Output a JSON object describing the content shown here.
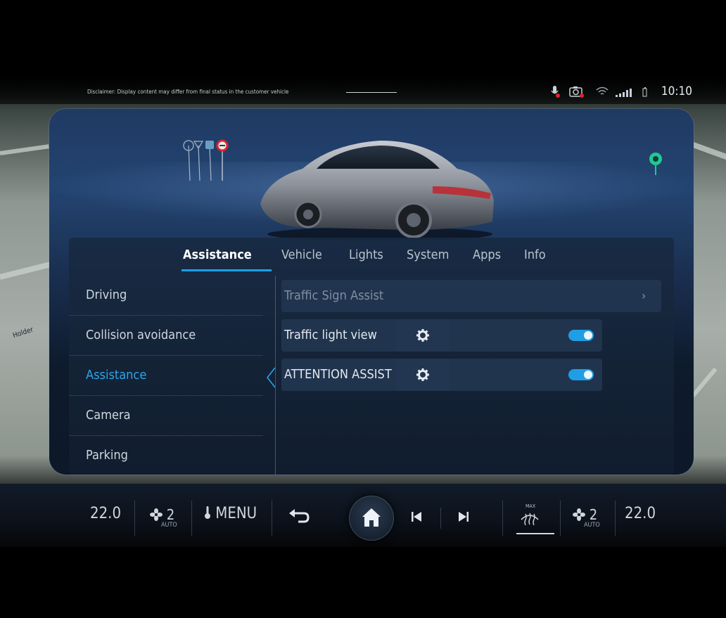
{
  "status": {
    "disclaimer": "Disclaimer: Display content may differ from final status in the customer vehicle",
    "time": "10:10"
  },
  "map": {
    "label": "Holder"
  },
  "tabs": [
    {
      "label": "Assistance",
      "active": true
    },
    {
      "label": "Vehicle"
    },
    {
      "label": "Lights"
    },
    {
      "label": "System"
    },
    {
      "label": "Apps"
    },
    {
      "label": "Info"
    }
  ],
  "categories": [
    {
      "label": "Driving"
    },
    {
      "label": "Collision avoidance"
    },
    {
      "label": "Assistance",
      "active": true
    },
    {
      "label": "Camera"
    },
    {
      "label": "Parking"
    }
  ],
  "settings": [
    {
      "label": "Traffic Sign Assist",
      "type": "link",
      "enabled": false
    },
    {
      "label": "Traffic light view",
      "type": "toggle",
      "on": true
    },
    {
      "label": "ATTENTION ASSIST",
      "type": "toggle",
      "on": true
    }
  ],
  "climate": {
    "left_temp": "22.0",
    "right_temp": "22.0",
    "left_fan": "2",
    "right_fan": "2",
    "fan_mode": "AUTO",
    "menu_label": "MENU",
    "defrost_label": "MAX"
  },
  "icons": {
    "back": "back-arrow-icon",
    "home": "home-icon",
    "prev": "skip-previous-icon",
    "next": "skip-next-icon"
  },
  "colors": {
    "accent": "#1aa0e6"
  }
}
